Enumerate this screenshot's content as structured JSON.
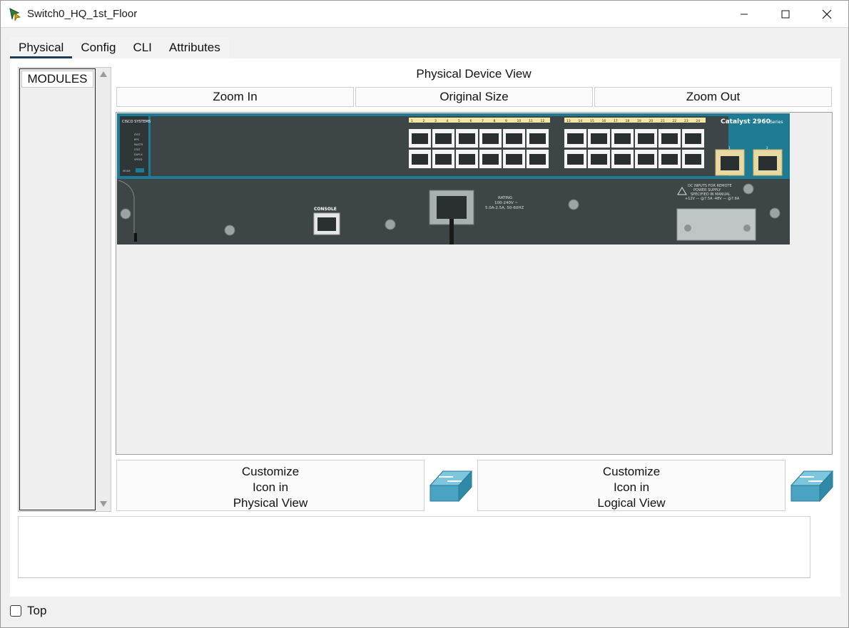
{
  "window": {
    "title": "Switch0_HQ_1st_Floor"
  },
  "tabs": [
    {
      "label": "Physical",
      "active": true
    },
    {
      "label": "Config",
      "active": false
    },
    {
      "label": "CLI",
      "active": false
    },
    {
      "label": "Attributes",
      "active": false
    }
  ],
  "modules": {
    "items": [
      "MODULES"
    ]
  },
  "device_view": {
    "title": "Physical Device View",
    "zoom_in_label": "Zoom In",
    "original_size_label": "Original Size",
    "zoom_out_label": "Zoom Out"
  },
  "device": {
    "brand": "CISCO SYSTEMS",
    "model": "Catalyst 2960",
    "series": "Series",
    "port_numbers": [
      "1",
      "2",
      "3",
      "4",
      "5",
      "6",
      "7",
      "8",
      "9",
      "10",
      "11",
      "12",
      "13",
      "14",
      "15",
      "16",
      "17",
      "18",
      "19",
      "20",
      "21",
      "22",
      "23",
      "24"
    ],
    "uplink_numbers": [
      "1",
      "2"
    ],
    "console_label": "CONSOLE",
    "rating_text": [
      "RATING",
      "100-240V ~",
      "5.0A-2.5A, 50-60HZ"
    ],
    "dc_text": [
      "DC INPUTS FOR REMOTE",
      "POWER SUPPLY",
      "SPECIFIED IN MANUAL",
      "+12V — @7.5A -48V — @7.8A"
    ],
    "led_labels": [
      "SYST",
      "RPS",
      "MASTR",
      "STAT",
      "DUPLX",
      "SPEED"
    ],
    "mode_label": "MODE"
  },
  "customize": {
    "physical_lines": [
      "Customize",
      "Icon in",
      "Physical View"
    ],
    "logical_lines": [
      "Customize",
      "Icon in",
      "Logical View"
    ]
  },
  "footer": {
    "top_label": "Top",
    "top_checked": false
  },
  "colors": {
    "switch_body": "#3d4547",
    "switch_accent": "#1f7a93",
    "port_label_bg": "#f3e6a5",
    "uplink_bg": "#e8d9a2",
    "tab_underline": "#1d3a5c"
  }
}
